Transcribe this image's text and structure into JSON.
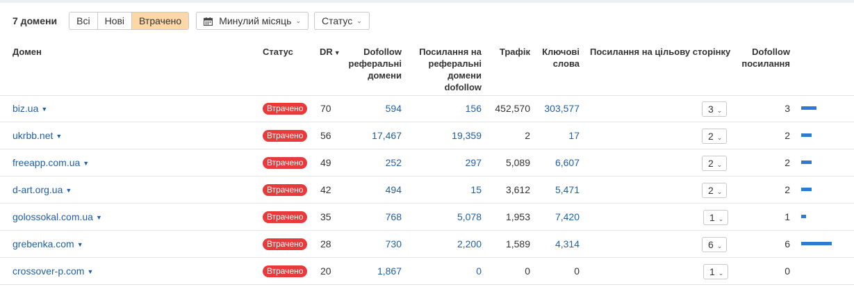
{
  "toolbar": {
    "count_label": "7 домени",
    "filters": [
      "Всі",
      "Нові",
      "Втрачено"
    ],
    "active_filter": 2,
    "period_label": "Минулий місяць",
    "status_label": "Статус"
  },
  "columns": {
    "domain": "Домен",
    "status": "Статус",
    "dr": "DR",
    "ref_domains": [
      "Dofollow",
      "реферальні",
      "домени"
    ],
    "links": [
      "Посилання на",
      "реферальні",
      "домени",
      "dofollow"
    ],
    "traffic": "Трафік",
    "keywords": [
      "Ключові",
      "слова"
    ],
    "target_links": "Посилання на цільову сторінку",
    "dofollow_links": [
      "Dofollow",
      "посилання"
    ]
  },
  "rows": [
    {
      "domain": "biz.ua",
      "status": "Втрачено",
      "dr": "70",
      "ref_domains": "594",
      "links": "156",
      "traffic": "452,570",
      "keywords": "303,577",
      "target": "3",
      "dofollow": "3",
      "bar_fraction": 0.5
    },
    {
      "domain": "ukrbb.net",
      "status": "Втрачено",
      "dr": "56",
      "ref_domains": "17,467",
      "links": "19,359",
      "traffic": "2",
      "keywords": "17",
      "target": "2",
      "dofollow": "2",
      "bar_fraction": 0.33
    },
    {
      "domain": "freeapp.com.ua",
      "status": "Втрачено",
      "dr": "49",
      "ref_domains": "252",
      "links": "297",
      "traffic": "5,089",
      "keywords": "6,607",
      "target": "2",
      "dofollow": "2",
      "bar_fraction": 0.33
    },
    {
      "domain": "d-art.org.ua",
      "status": "Втрачено",
      "dr": "42",
      "ref_domains": "494",
      "links": "15",
      "traffic": "3,612",
      "keywords": "5,471",
      "target": "2",
      "dofollow": "2",
      "bar_fraction": 0.33
    },
    {
      "domain": "golossokal.com.ua",
      "status": "Втрачено",
      "dr": "35",
      "ref_domains": "768",
      "links": "5,078",
      "traffic": "1,953",
      "keywords": "7,420",
      "target": "1",
      "dofollow": "1",
      "bar_fraction": 0.16
    },
    {
      "domain": "grebenka.com",
      "status": "Втрачено",
      "dr": "28",
      "ref_domains": "730",
      "links": "2,200",
      "traffic": "1,589",
      "keywords": "4,314",
      "target": "6",
      "dofollow": "6",
      "bar_fraction": 1.0
    },
    {
      "domain": "crossover-p.com",
      "status": "Втрачено",
      "dr": "20",
      "ref_domains": "1,867",
      "links": "0",
      "traffic": "0",
      "keywords": "0",
      "target": "1",
      "dofollow": "0",
      "bar_fraction": 0
    }
  ],
  "colors": {
    "accent_link": "#1f5fa8",
    "lost_badge": "#e83a3a",
    "active_filter": "#fdd8a6",
    "bar": "#2f7ad1"
  }
}
